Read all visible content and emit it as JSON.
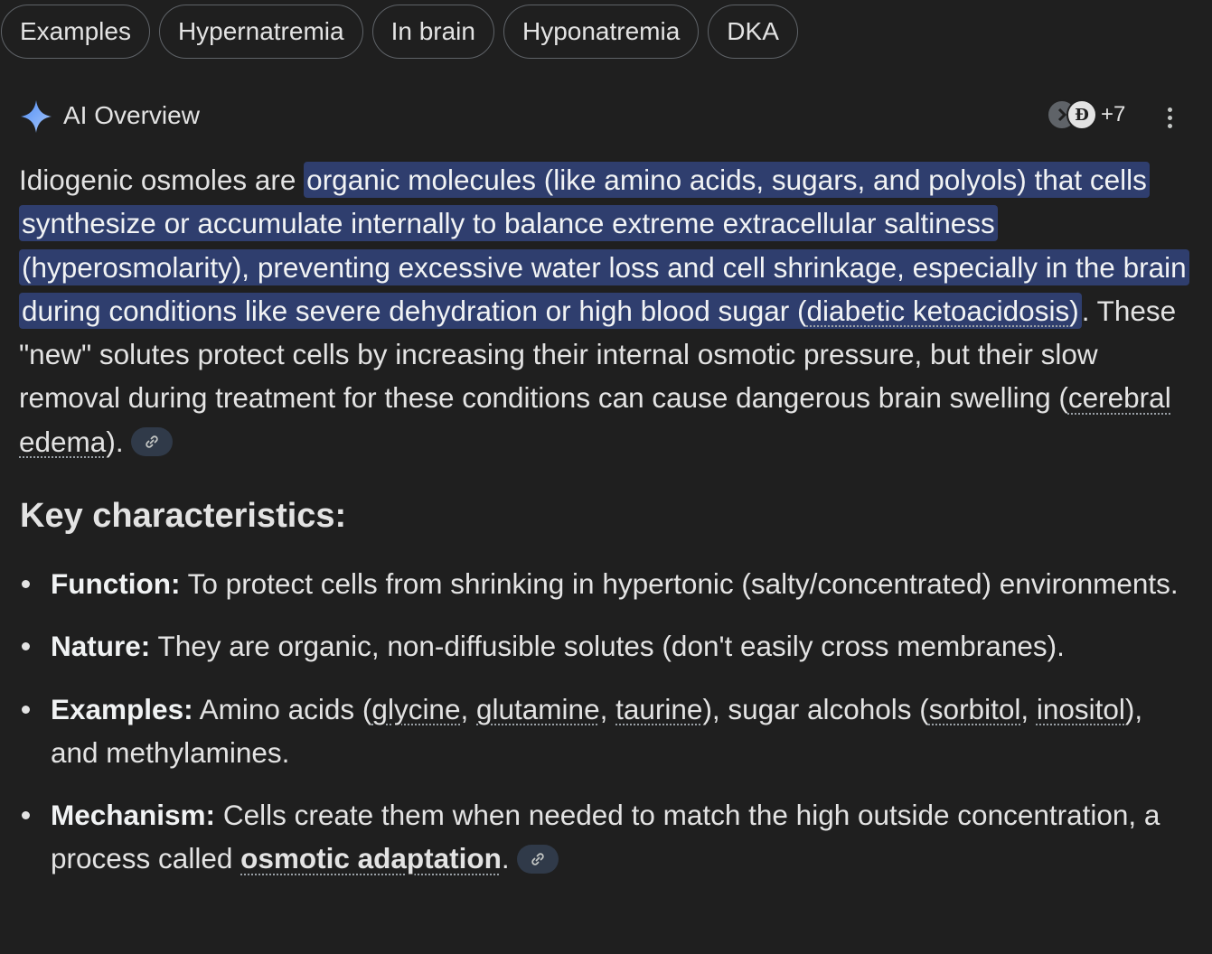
{
  "chips": [
    "Examples",
    "Hypernatremia",
    "In brain",
    "Hyponatremia",
    "DKA"
  ],
  "overview": {
    "title": "AI Overview",
    "sources_count": "+7",
    "source_b_glyph": "Ð",
    "accent": "#8ab4f8",
    "highlight_color": "#2f3e6e"
  },
  "para": {
    "p1": "Idiogenic osmoles are ",
    "hl1": "organic molecules (like amino acids, sugars, and polyols) that cells synthesize or accumulate internally to balance extreme extracellular saltiness (hyperosmolarity), preventing excessive water loss and cell shrinkage, especially in the brain during conditions like severe dehydration or high blood sugar (",
    "hl_link": "diabetic ketoacidosis",
    "hl2": ")",
    "p2": ". These \"new\" solutes protect cells by increasing their internal osmotic pressure, but their slow removal during treatment for these conditions can cause dangerous brain swelling (",
    "p2_link": "cerebral edema",
    "p3": ")."
  },
  "heading": "Key characteristics:",
  "bullets": {
    "function": {
      "label": "Function:",
      "text": " To protect cells from shrinking in hypertonic (salty/concentrated) environments."
    },
    "nature": {
      "label": "Nature:",
      "text": " They are organic, non-diffusible solutes (don't easily cross membranes)."
    },
    "examples": {
      "label": "Examples:",
      "t1": " Amino acids (",
      "l1": "glycine",
      "s1": ", ",
      "l2": "glutamine",
      "s2": ", ",
      "l3": "taurine",
      "t2": "), sugar alcohols (",
      "l4": "sorbitol",
      "s3": ", ",
      "l5": "inositol",
      "t3": "), and methylamines."
    },
    "mechanism": {
      "label": "Mechanism:",
      "t1": " Cells create them when needed to match the high outside concentration, a process called ",
      "link": "osmotic adaptation",
      "t2": "."
    }
  }
}
